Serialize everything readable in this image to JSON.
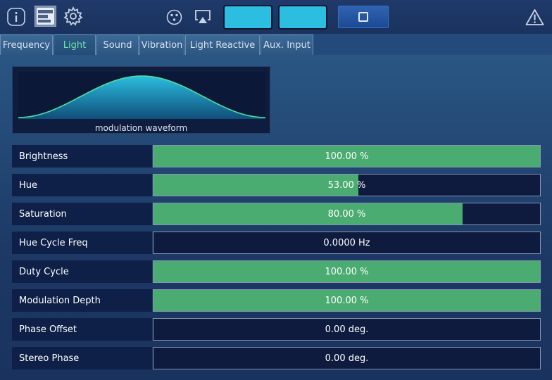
{
  "toolbar": {
    "icons": [
      "info-icon",
      "panel-icon",
      "gear-icon",
      "dmx-icon",
      "airplay-icon",
      "warning-icon"
    ],
    "accent_color": "#2bbee0"
  },
  "tabs": [
    {
      "label": "Frequency",
      "active": false
    },
    {
      "label": "Light",
      "active": true
    },
    {
      "label": "Sound",
      "active": false
    },
    {
      "label": "Vibration",
      "active": false
    },
    {
      "label": "Light Reactive",
      "active": false
    },
    {
      "label": "Aux. Input",
      "active": false
    }
  ],
  "waveform": {
    "label": "modulation waveform",
    "fill_color": "#2bbee0",
    "line_color": "#4ee0a0"
  },
  "params": [
    {
      "label": "Brightness",
      "value": "100.00 %",
      "fill": 1.0
    },
    {
      "label": "Hue",
      "value": "53.00 %",
      "fill": 0.53
    },
    {
      "label": "Saturation",
      "value": "80.00 %",
      "fill": 0.8
    },
    {
      "label": "Hue Cycle Freq",
      "value": "0.0000 Hz",
      "fill": 0
    },
    {
      "label": "Duty Cycle",
      "value": "100.00 %",
      "fill": 1.0
    },
    {
      "label": "Modulation Depth",
      "value": "100.00 %",
      "fill": 1.0
    },
    {
      "label": "Phase Offset",
      "value": "0.00 deg.",
      "fill": 0
    },
    {
      "label": "Stereo Phase",
      "value": "0.00 deg.",
      "fill": 0
    }
  ],
  "colors": {
    "bar_fill": "#4aac70",
    "active_tab_text": "#6ee3a8"
  }
}
